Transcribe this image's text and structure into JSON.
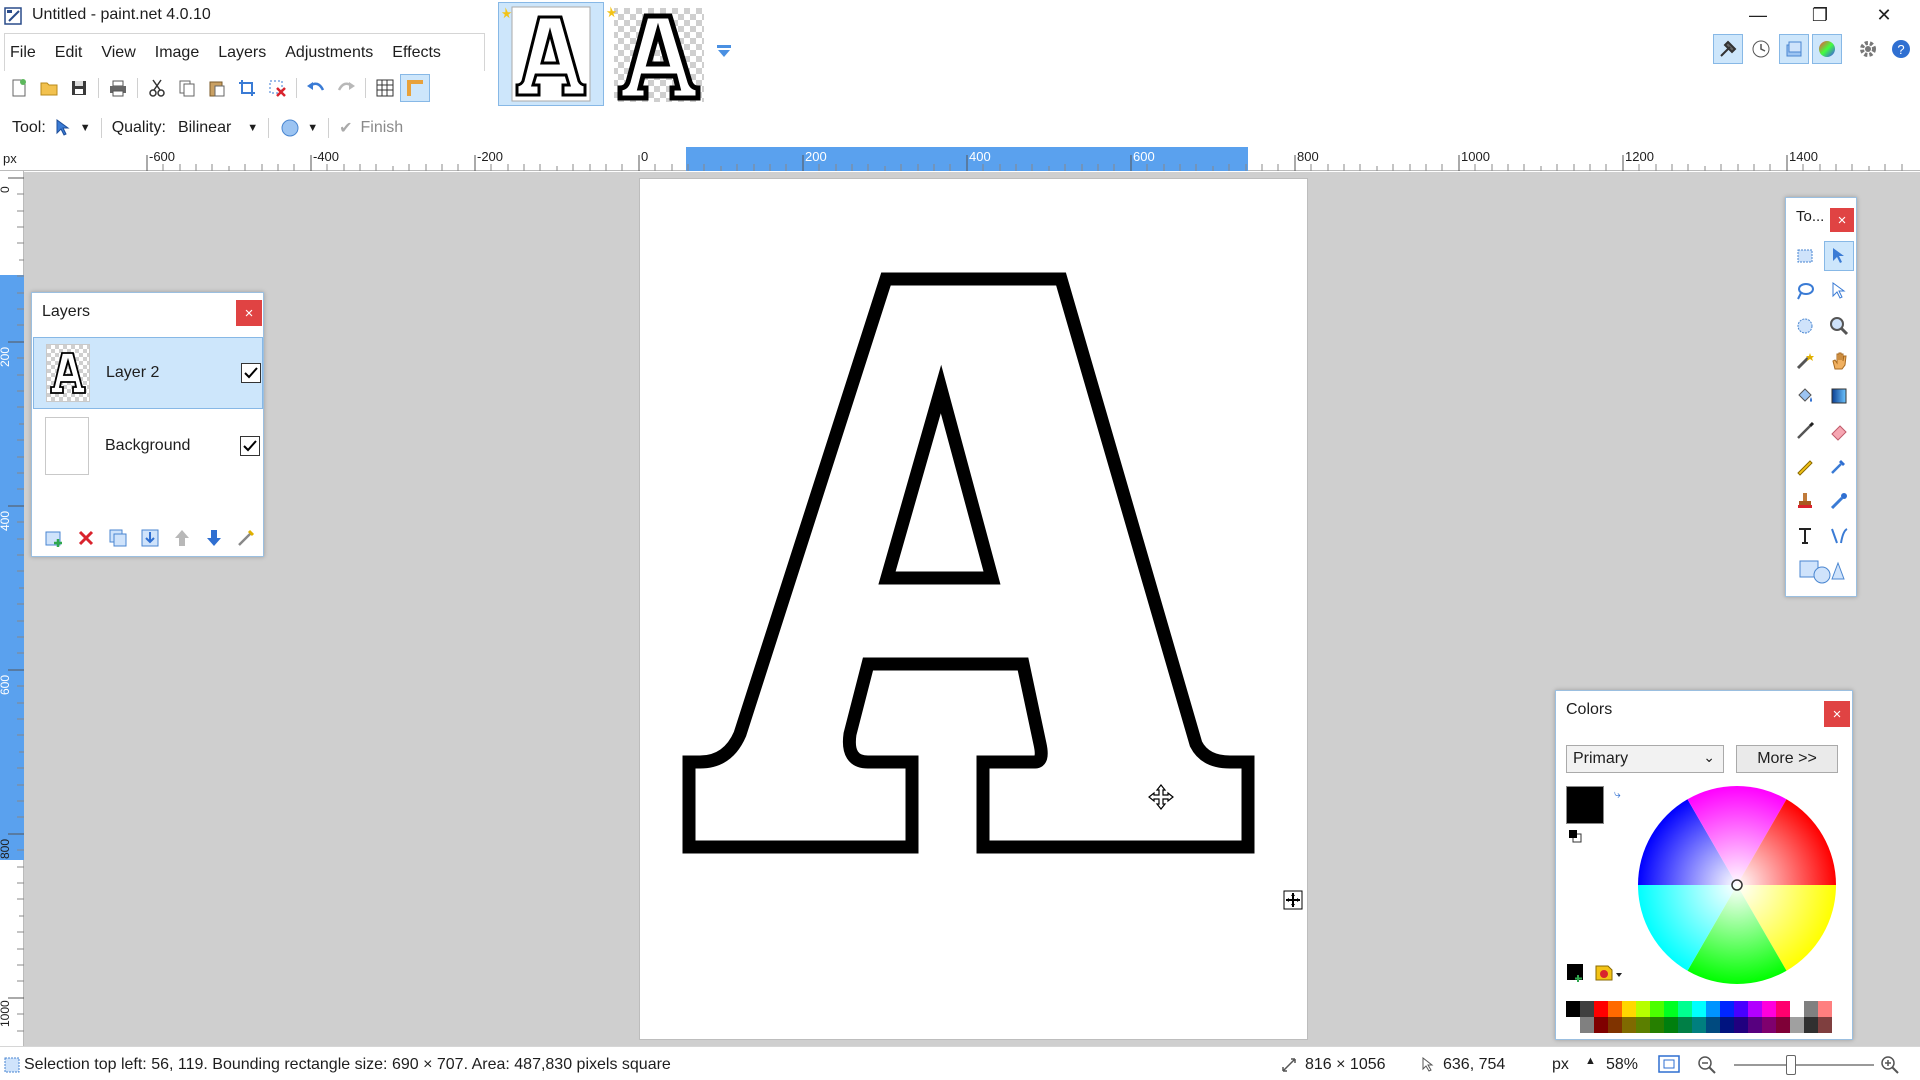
{
  "window": {
    "title": "Untitled - paint.net 4.0.10",
    "minimize": "—",
    "restore": "❐",
    "close": "✕"
  },
  "menu": [
    "File",
    "Edit",
    "View",
    "Image",
    "Layers",
    "Adjustments",
    "Effects"
  ],
  "tool_options": {
    "tool_label": "Tool:",
    "quality_label": "Quality:",
    "quality_value": "Bilinear",
    "finish_label": "Finish"
  },
  "rulers": {
    "unit": "px",
    "h_ticks": [
      "-600",
      "-400",
      "-200",
      "0",
      "200",
      "400",
      "600",
      "800",
      "1000",
      "1200",
      "1400"
    ],
    "v_ticks": [
      "0",
      "200",
      "400",
      "600",
      "800",
      "1000"
    ]
  },
  "layers": {
    "title": "Layers",
    "items": [
      {
        "name": "Layer 2",
        "visible": true,
        "selected": true
      },
      {
        "name": "Background",
        "visible": true,
        "selected": false
      }
    ]
  },
  "tools": {
    "title": "To..."
  },
  "colors": {
    "title": "Colors",
    "mode": "Primary",
    "more_label": "More >>",
    "primary": "#000000",
    "secondary": "#ffffff",
    "palette_top": [
      "#000000",
      "#404040",
      "#ff0000",
      "#ff6a00",
      "#ffd800",
      "#b6ff00",
      "#4cff00",
      "#00ff21",
      "#00ff90",
      "#00ffff",
      "#0094ff",
      "#0026ff",
      "#4800ff",
      "#b200ff",
      "#ff00dc",
      "#ff006e",
      "#ffffff",
      "#808080",
      "#ff7f7f"
    ],
    "palette_bottom": [
      "#ffffff",
      "#808080",
      "#7f0000",
      "#7f3300",
      "#7f6a00",
      "#5b7f00",
      "#267f00",
      "#007f0e",
      "#007f46",
      "#007f7f",
      "#004a7f",
      "#00137f",
      "#21007f",
      "#57007f",
      "#7f006e",
      "#7f0037",
      "#a0a0a0",
      "#303030",
      "#7f3f3f"
    ]
  },
  "status": {
    "selection": "Selection top left: 56, 119. Bounding rectangle size: 690 × 707. Area: 487,830 pixels square",
    "image_size": "816 × 1056",
    "cursor": "636, 754",
    "unit": "px",
    "zoom": "58%",
    "zoom_level": 0.58
  }
}
